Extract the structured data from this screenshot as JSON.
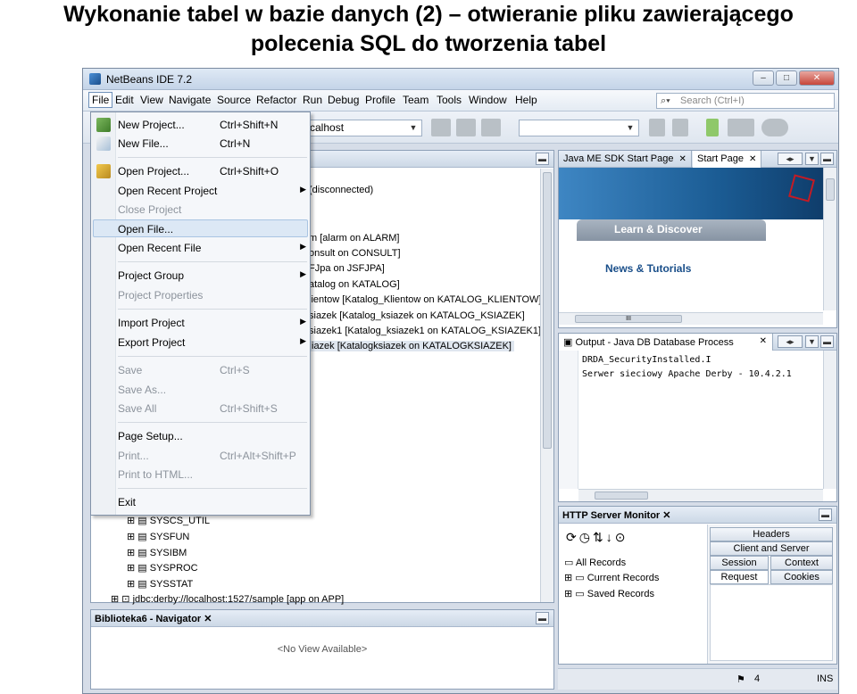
{
  "slide": {
    "title_line1": "Wykonanie tabel w bazie danych (2) – otwieranie pliku zawierającego",
    "title_line2": "polecenia SQL do tworzenia tabel"
  },
  "window": {
    "title": "NetBeans IDE 7.2",
    "buttons": [
      "–",
      "□",
      "✕"
    ]
  },
  "menubar": {
    "items": [
      "File",
      "Edit",
      "View",
      "Navigate",
      "Source",
      "Refactor",
      "Run",
      "Debug",
      "Profile",
      "Team",
      "Tools",
      "Window",
      "Help"
    ],
    "search_placeholder": "Search (Ctrl+I)"
  },
  "toolbar": {
    "host_combo": "calhost"
  },
  "file_menu": {
    "items": [
      {
        "label": "New Project...",
        "shortcut": "Ctrl+Shift+N"
      },
      {
        "label": "New File...",
        "shortcut": "Ctrl+N"
      },
      {
        "label": "Open Project...",
        "shortcut": "Ctrl+Shift+O"
      },
      {
        "label": "Open Recent Project",
        "shortcut": ""
      },
      {
        "label": "Close Project",
        "shortcut": ""
      },
      {
        "label": "Open File...",
        "shortcut": ""
      },
      {
        "label": "Open Recent File",
        "shortcut": ""
      },
      {
        "label": "Project Group",
        "shortcut": ""
      },
      {
        "label": "Project Properties",
        "shortcut": ""
      },
      {
        "label": "Import Project",
        "shortcut": ""
      },
      {
        "label": "Export Project",
        "shortcut": ""
      },
      {
        "label": "Save",
        "shortcut": "Ctrl+S"
      },
      {
        "label": "Save As...",
        "shortcut": ""
      },
      {
        "label": "Save All",
        "shortcut": "Ctrl+Shift+S"
      },
      {
        "label": "Page Setup...",
        "shortcut": ""
      },
      {
        "label": "Print...",
        "shortcut": "Ctrl+Alt+Shift+P"
      },
      {
        "label": "Print to HTML...",
        "shortcut": ""
      },
      {
        "label": "Exit",
        "shortcut": ""
      }
    ]
  },
  "services": {
    "rows": [
      "(disconnected)",
      "m [alarm on ALARM]",
      "onsult on CONSULT]",
      "FJpa on JSFJPA]",
      "atalog on KATALOG]",
      "lientow [Katalog_Klientow on KATALOG_KLIENTOW]",
      "siazek [Katalog_ksiazek on KATALOG_KSIAZEK]",
      "siazek1 [Katalog_ksiazek1 on KATALOG_KSIAZEK1]",
      "iazek [Katalogksiazek on KATALOGKSIAZEK]"
    ],
    "schemas": [
      "SYSCS_UTIL",
      "SYSFUN",
      "SYSIBM",
      "SYSPROC",
      "SYSSTAT"
    ],
    "connection": "jdbc:derby://localhost:1527/sample [app on APP]"
  },
  "navigator": {
    "title": "Biblioteka6 - Navigator",
    "empty": "<No View Available>"
  },
  "editor": {
    "tabs": [
      "Java ME SDK Start Page",
      "Start Page"
    ],
    "learn": "Learn & Discover",
    "news": "News & Tutorials",
    "scroll_mark": "III"
  },
  "output": {
    "title": "Output - Java DB Database Process",
    "lines": [
      "DRDA_SecurityInstalled.I",
      "Serwer sieciowy Apache Derby - 10.4.2.1"
    ]
  },
  "http": {
    "title": "HTTP Server Monitor",
    "records": [
      "All Records",
      "Current Records",
      "Saved Records"
    ],
    "tabs": [
      "Headers",
      "Client and Server",
      "Session",
      "Context",
      "Request",
      "Cookies"
    ]
  },
  "status": {
    "count": "4",
    "mode": "INS"
  },
  "colors": {
    "start_blue": "#1b5c94",
    "start_dark": "#0f3d6b",
    "news_blue": "#1a4f8a"
  }
}
